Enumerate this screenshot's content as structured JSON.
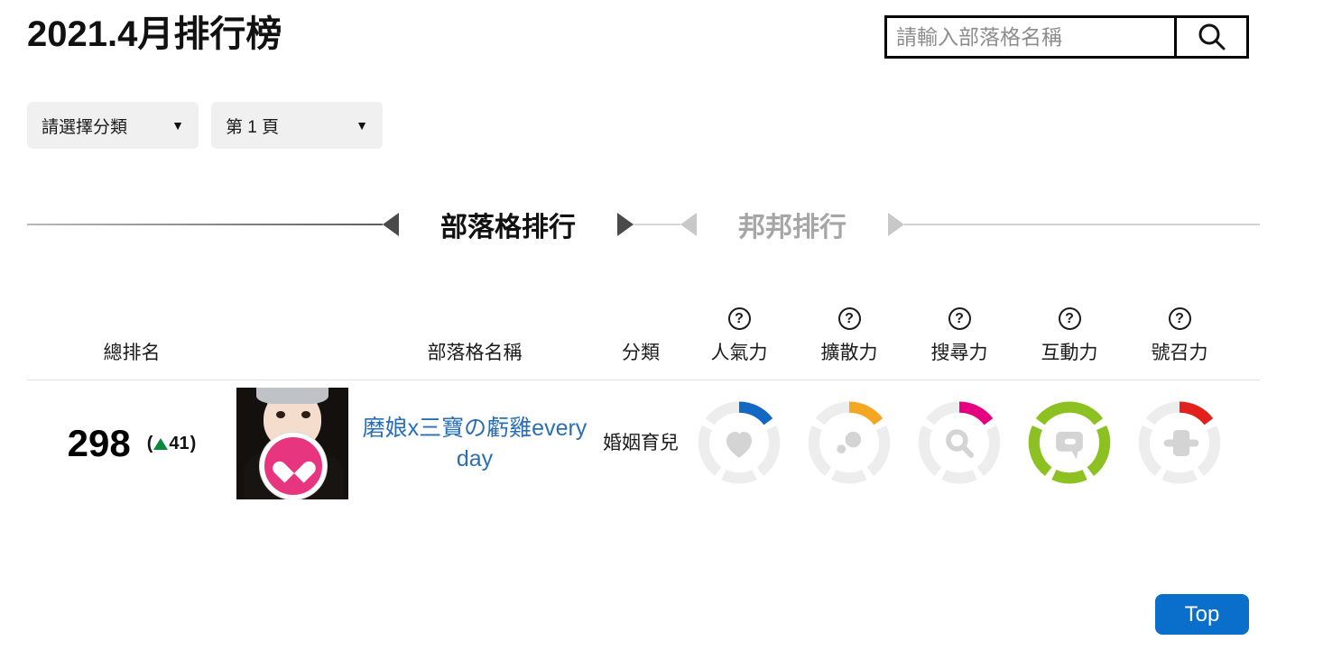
{
  "header": {
    "title": "2021.4月排行榜",
    "search": {
      "placeholder": "請輸入部落格名稱",
      "value": "",
      "button_icon": "search-icon"
    }
  },
  "filters": [
    {
      "label": "請選擇分類",
      "caret": "▼"
    },
    {
      "label": "第 1 頁",
      "caret": "▼"
    }
  ],
  "tabs": [
    {
      "label": "部落格排行",
      "active": true
    },
    {
      "label": "邦邦排行",
      "active": false
    }
  ],
  "table": {
    "headers": {
      "rank": "總排名",
      "avatar": "",
      "name": "部落格名稱",
      "category": "分類",
      "metrics": [
        {
          "label": "人氣力",
          "help": "?",
          "icon": "heart-icon",
          "color": "#1368c4"
        },
        {
          "label": "擴散力",
          "help": "?",
          "icon": "share-bubbles-icon",
          "color": "#f5a623"
        },
        {
          "label": "搜尋力",
          "help": "?",
          "icon": "magnifier-icon",
          "color": "#e4007f"
        },
        {
          "label": "互動力",
          "help": "?",
          "icon": "chat-bubble-icon",
          "color": "#8cc121"
        },
        {
          "label": "號召力",
          "help": "?",
          "icon": "plus-cross-icon",
          "color": "#e2211c"
        }
      ]
    },
    "rows": [
      {
        "rank": "298",
        "delta_open": "(",
        "delta_arrow": "▲",
        "delta_value": "41",
        "delta_close": ")",
        "delta_direction": "up",
        "delta_color": "#0a8a3c",
        "avatar_alt": "磨娘x三寶の虧雞every day 頭像",
        "name": "磨娘x三寶の虧雞every day",
        "category": "婚姻育兒",
        "metrics": [
          {
            "name": "人氣力",
            "filled": 1,
            "total": 5,
            "color": "#1368c4"
          },
          {
            "name": "擴散力",
            "filled": 1,
            "total": 5,
            "color": "#f5a623"
          },
          {
            "name": "搜尋力",
            "filled": 1,
            "total": 5,
            "color": "#e4007f"
          },
          {
            "name": "互動力",
            "filled": 5,
            "total": 5,
            "color": "#8cc121"
          },
          {
            "name": "號召力",
            "filled": 1,
            "total": 5,
            "color": "#e2211c"
          }
        ]
      }
    ]
  },
  "footer": {
    "top_button": "Top",
    "top_button_color": "#0a6fca"
  }
}
